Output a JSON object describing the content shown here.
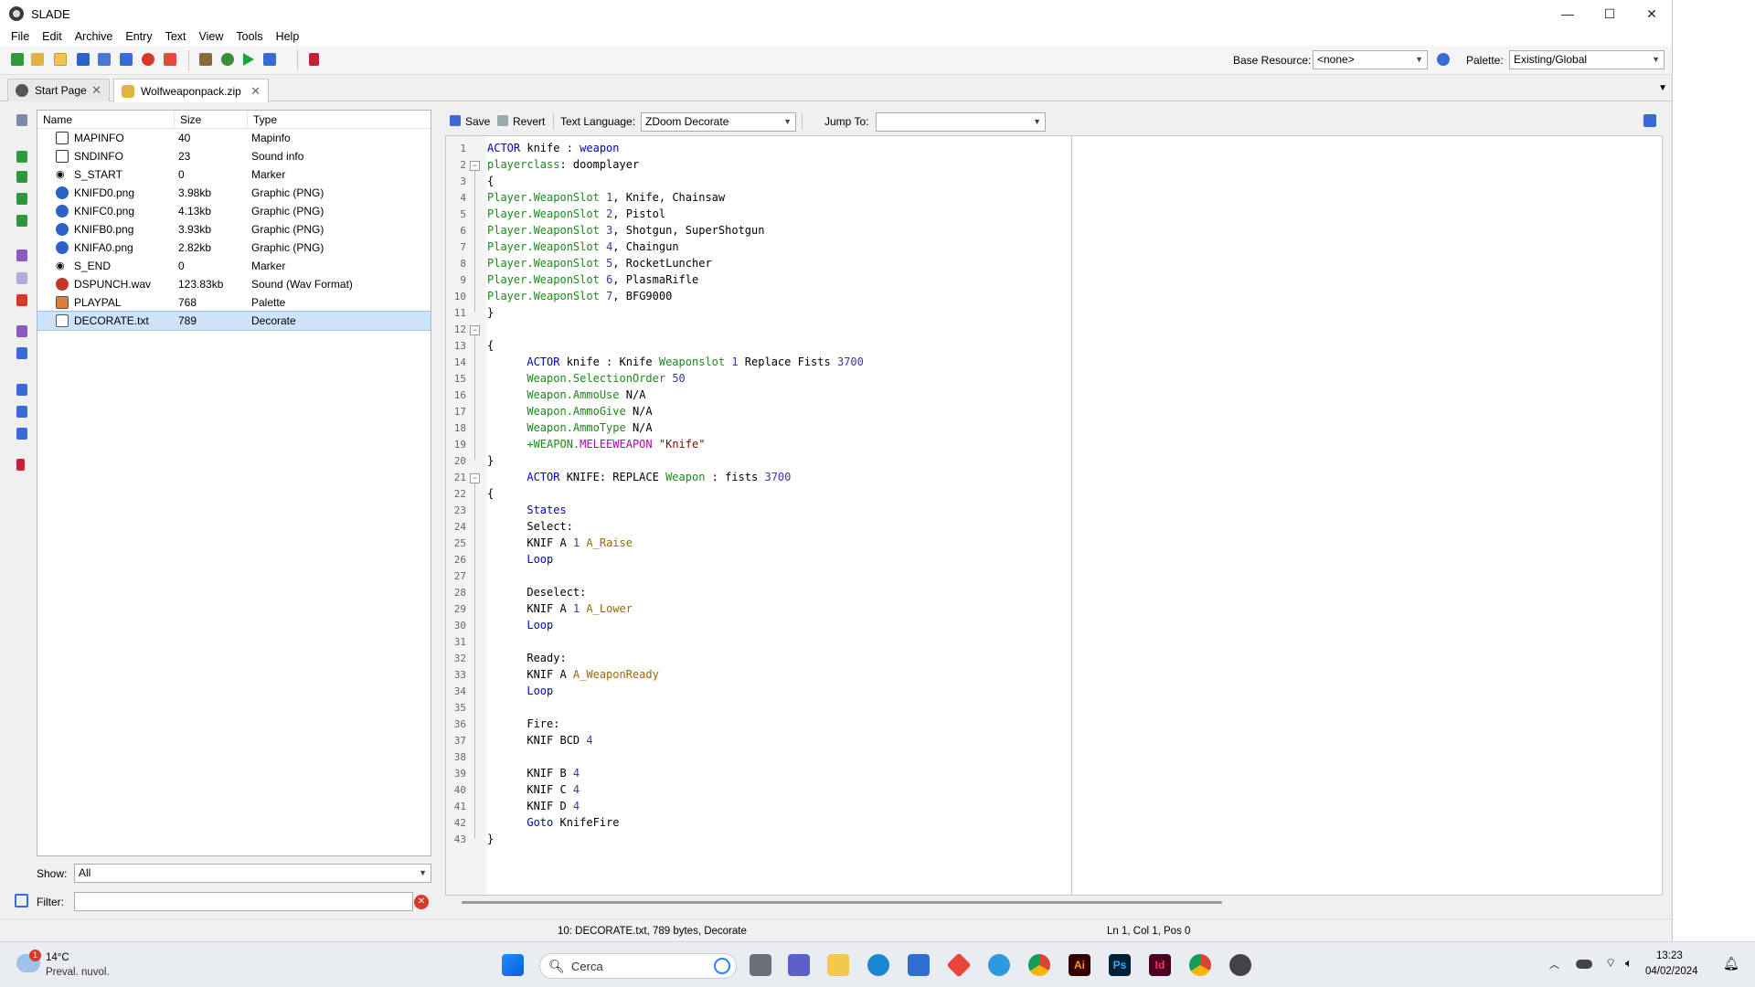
{
  "window": {
    "title": "SLADE",
    "minimize": "—",
    "maximize": "☐",
    "close": "✕"
  },
  "menu": [
    "File",
    "Edit",
    "Archive",
    "Entry",
    "Text",
    "View",
    "Tools",
    "Help"
  ],
  "toolbar": {
    "base_resource_label": "Base Resource:",
    "base_resource_value": "<none>",
    "palette_label": "Palette:",
    "palette_value": "Existing/Global"
  },
  "tabs": [
    {
      "label": "Start Page",
      "close": "✕"
    },
    {
      "label": "Wolfweaponpack.zip",
      "close": "✕"
    }
  ],
  "filelist": {
    "headers": {
      "name": "Name",
      "size": "Size",
      "type": "Type"
    },
    "entries": [
      {
        "name": "MAPINFO",
        "size": "40",
        "type": "Mapinfo",
        "icon": "text-doc-icon"
      },
      {
        "name": "SNDINFO",
        "size": "23",
        "type": "Sound info",
        "icon": "text-doc-icon"
      },
      {
        "name": "S_START",
        "size": "0",
        "type": "Marker",
        "icon": "eye-marker-icon"
      },
      {
        "name": "KNIFD0.png",
        "size": "3.98kb",
        "type": "Graphic (PNG)",
        "icon": "png-graphic-icon"
      },
      {
        "name": "KNIFC0.png",
        "size": "4.13kb",
        "type": "Graphic (PNG)",
        "icon": "png-graphic-icon"
      },
      {
        "name": "KNIFB0.png",
        "size": "3.93kb",
        "type": "Graphic (PNG)",
        "icon": "png-graphic-icon"
      },
      {
        "name": "KNIFA0.png",
        "size": "2.82kb",
        "type": "Graphic (PNG)",
        "icon": "png-graphic-icon"
      },
      {
        "name": "S_END",
        "size": "0",
        "type": "Marker",
        "icon": "eye-marker-icon"
      },
      {
        "name": "DSPUNCH.wav",
        "size": "123.83kb",
        "type": "Sound (Wav Format)",
        "icon": "sound-icon"
      },
      {
        "name": "PLAYPAL",
        "size": "768",
        "type": "Palette",
        "icon": "palette-icon"
      },
      {
        "name": "DECORATE.txt",
        "size": "789",
        "type": "Decorate",
        "icon": "decorate-icon"
      }
    ],
    "selected_index": 10
  },
  "show": {
    "label": "Show:",
    "value": "All"
  },
  "filter": {
    "label": "Filter:",
    "value": ""
  },
  "editor_toolbar": {
    "save": "Save",
    "revert": "Revert",
    "text_language_label": "Text Language:",
    "text_language_value": "ZDoom Decorate",
    "jump_to_label": "Jump To:",
    "jump_to_value": ""
  },
  "code_lines": [
    "ACTOR knife : weapon",
    "playerclass: doomplayer",
    "{",
    "Player.WeaponSlot 1, Knife, Chainsaw",
    "Player.WeaponSlot 2, Pistol",
    "Player.WeaponSlot 3, Shotgun, SuperShotgun",
    "Player.WeaponSlot 4, Chaingun",
    "Player.WeaponSlot 5, RocketLuncher",
    "Player.WeaponSlot 6, PlasmaRifle",
    "Player.WeaponSlot 7, BFG9000",
    "}",
    "",
    "{",
    "      ACTOR knife : Knife Weaponslot 1 Replace Fists 3700",
    "      Weapon.SelectionOrder 50",
    "      Weapon.AmmoUse N/A",
    "      Weapon.AmmoGive N/A",
    "      Weapon.AmmoType N/A",
    "      +WEAPON.MELEEWEAPON \"Knife\"",
    "}",
    "      ACTOR KNIFE: REPLACE Weapon : fists 3700",
    "{",
    "      States",
    "      Select:",
    "      KNIF A 1 A_Raise",
    "      Loop",
    "",
    "      Deselect:",
    "      KNIF A 1 A_Lower",
    "      Loop",
    "",
    "      Ready:",
    "      KNIF A A_WeaponReady",
    "      Loop",
    "",
    "      Fire:",
    "      KNIF BCD 4",
    "",
    "      KNIF B 4",
    "      KNIF C 4",
    "      KNIF D 4",
    "      Goto KnifeFire",
    "}"
  ],
  "statusbar": {
    "entry_info": "10: DECORATE.txt, 789 bytes, Decorate",
    "cursor": "Ln 1, Col 1, Pos 0"
  },
  "taskbar": {
    "weather_temp": "14°C",
    "weather_desc": "Preval. nuvol.",
    "weather_badge": "1",
    "search_placeholder": "Cerca",
    "time": "13:23",
    "date": "04/02/2024",
    "ai_label": "Ai",
    "ps_label": "Ps",
    "id_label": "Id"
  }
}
